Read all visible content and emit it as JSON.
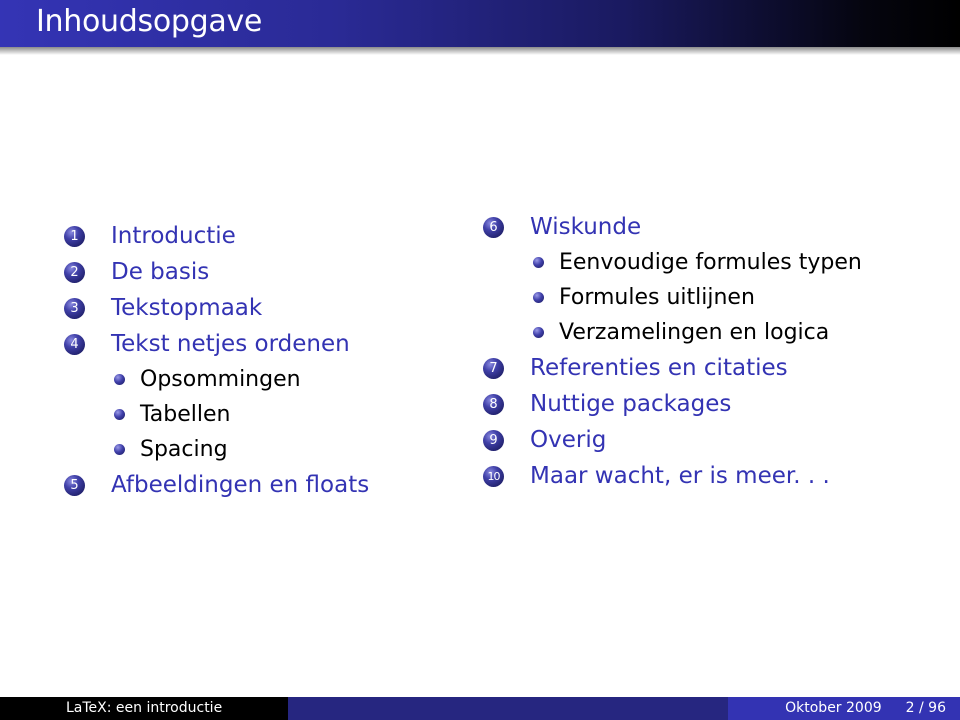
{
  "header": {
    "title": "Inhoudsopgave"
  },
  "toc": {
    "left": [
      {
        "type": "section",
        "number": "1",
        "label": "Introductie"
      },
      {
        "type": "section",
        "number": "2",
        "label": "De basis"
      },
      {
        "type": "section",
        "number": "3",
        "label": "Tekstopmaak"
      },
      {
        "type": "section",
        "number": "4",
        "label": "Tekst netjes ordenen"
      },
      {
        "type": "subsection",
        "label": "Opsommingen"
      },
      {
        "type": "subsection",
        "label": "Tabellen"
      },
      {
        "type": "subsection",
        "label": "Spacing"
      },
      {
        "type": "section",
        "number": "5",
        "label": "Afbeeldingen en floats"
      }
    ],
    "right": [
      {
        "type": "section",
        "number": "6",
        "label": "Wiskunde"
      },
      {
        "type": "subsection",
        "label": "Eenvoudige formules typen"
      },
      {
        "type": "subsection",
        "label": "Formules uitlijnen"
      },
      {
        "type": "subsection",
        "label": "Verzamelingen en logica"
      },
      {
        "type": "section",
        "number": "7",
        "label": "Referenties en citaties"
      },
      {
        "type": "section",
        "number": "8",
        "label": "Nuttige packages"
      },
      {
        "type": "section",
        "number": "9",
        "label": "Overig"
      },
      {
        "type": "section",
        "number": "10",
        "label": "Maar wacht, er is meer. . ."
      }
    ]
  },
  "footer": {
    "short_title": "LaTeX: een introductie",
    "date": "Oktober 2009",
    "page": "2 / 96"
  },
  "colors": {
    "accent": "#3333b3",
    "footer_mid": "#262680",
    "footer_left": "#000000"
  }
}
